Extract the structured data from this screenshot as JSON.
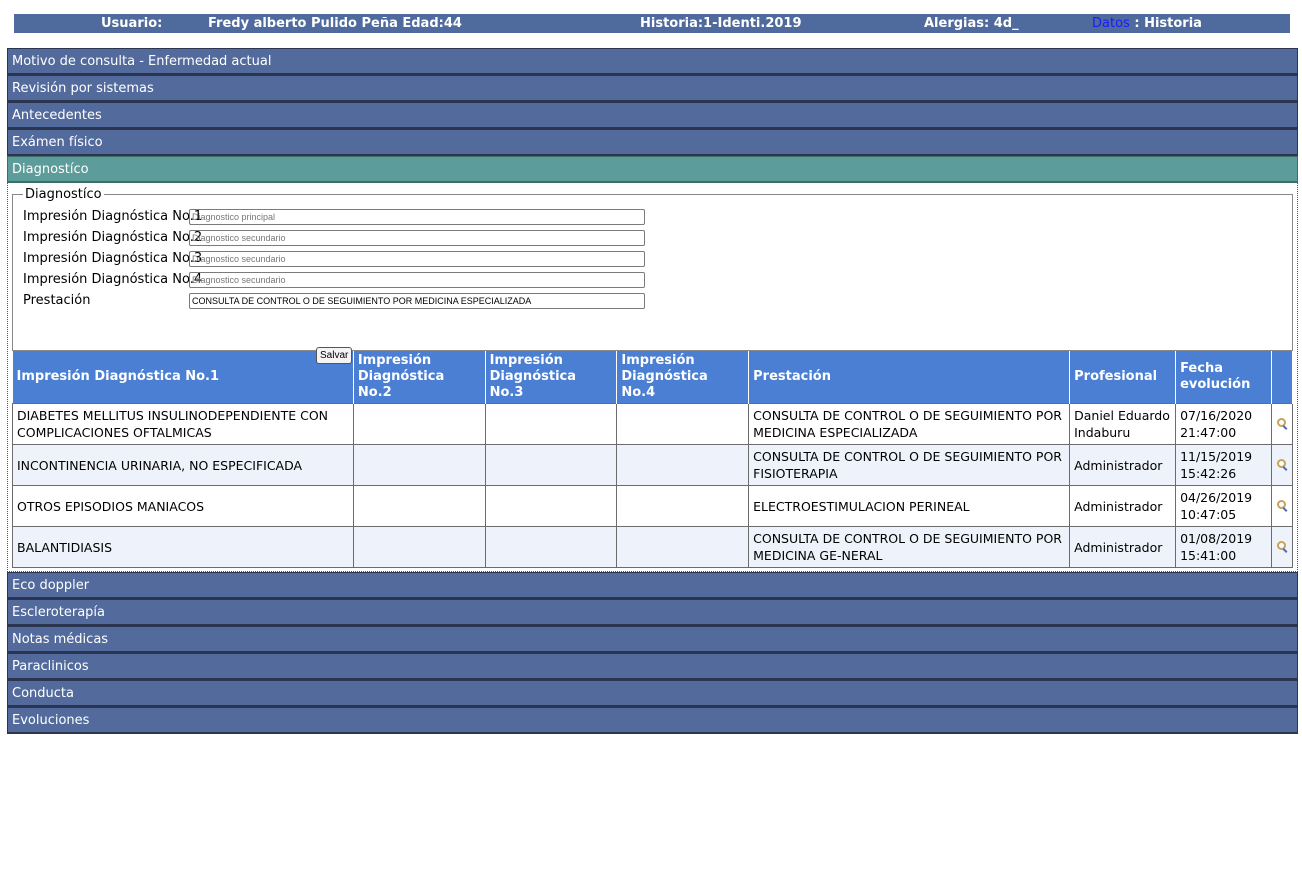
{
  "header": {
    "usuario_label": "Usuario:",
    "usuario_name": "Fredy alberto Pulido Peña Edad:44",
    "historia": "Historia:1-Identi.2019",
    "alergias": "Alergias: 4d_",
    "datos_link": "Datos",
    "datos_suffix": " : Historia",
    "link_color": "#1a1aff"
  },
  "sections_top": [
    {
      "label": "Motivo de consulta - Enfermedad actual"
    },
    {
      "label": "Revisión por sistemas"
    },
    {
      "label": "Antecedentes"
    },
    {
      "label": "Exámen físico"
    }
  ],
  "active_section": {
    "label": "Diagnostíco"
  },
  "form": {
    "legend": "Diagnostíco",
    "fields": [
      {
        "label": "Impresión Diagnóstica No.1",
        "placeholder": "Diagnostico principal",
        "value": ""
      },
      {
        "label": "Impresión Diagnóstica No.2",
        "placeholder": "Diagnostico secundario",
        "value": ""
      },
      {
        "label": "Impresión Diagnóstica No.3",
        "placeholder": "Diagnostico secundario",
        "value": ""
      },
      {
        "label": "Impresión Diagnóstica No.4",
        "placeholder": "Diagnostico secundario",
        "value": ""
      },
      {
        "label": "Prestación",
        "placeholder": "",
        "value": "CONSULTA DE CONTROL O DE SEGUIMIENTO POR MEDICINA ESPECIALIZADA"
      }
    ],
    "save_label": "Salvar"
  },
  "table": {
    "headers": [
      "Impresión Diagnóstica No.1",
      "Impresión Diagnóstica No.2",
      "Impresión Diagnóstica No.3",
      "Impresión Diagnóstica No.4",
      "Prestación",
      "Profesional",
      "Fecha evolución"
    ],
    "rows": [
      {
        "d1": "DIABETES MELLITUS INSULINODEPENDIENTE CON COMPLICACIONES OFTALMICAS",
        "d2": "",
        "d3": "",
        "d4": "",
        "prestacion": "CONSULTA DE CONTROL O DE SEGUIMIENTO POR MEDICINA ESPECIALIZADA",
        "profesional": "Daniel Eduardo Indaburu",
        "fecha": "07/16/2020 21:47:00"
      },
      {
        "d1": "INCONTINENCIA URINARIA, NO ESPECIFICADA",
        "d2": "",
        "d3": "",
        "d4": "",
        "prestacion": "CONSULTA DE CONTROL O DE SEGUIMIENTO POR FISIOTERAPIA",
        "profesional": "Administrador",
        "fecha": "11/15/2019 15:42:26"
      },
      {
        "d1": "OTROS EPISODIOS MANIACOS",
        "d2": "",
        "d3": "",
        "d4": "",
        "prestacion": "ELECTROESTIMULACION PERINEAL",
        "profesional": "Administrador",
        "fecha": "04/26/2019 10:47:05"
      },
      {
        "d1": "BALANTIDIASIS",
        "d2": "",
        "d3": "",
        "d4": "",
        "prestacion": "CONSULTA DE CONTROL O DE SEGUIMIENTO POR MEDICINA GE-NERAL",
        "profesional": "Administrador",
        "fecha": "01/08/2019 15:41:00"
      }
    ],
    "row_icon": "magnifier-icon"
  },
  "sections_bottom": [
    {
      "label": "Eco doppler"
    },
    {
      "label": "Escleroterapía"
    },
    {
      "label": "Notas médicas"
    },
    {
      "label": "Paraclinicos"
    },
    {
      "label": "Conducta"
    },
    {
      "label": "Evoluciones"
    }
  ],
  "colors": {
    "header_bar": "#4f6a9c",
    "section_header": "#536b9c",
    "active_section": "#5c9c9a",
    "table_header": "#4a7fd4"
  }
}
